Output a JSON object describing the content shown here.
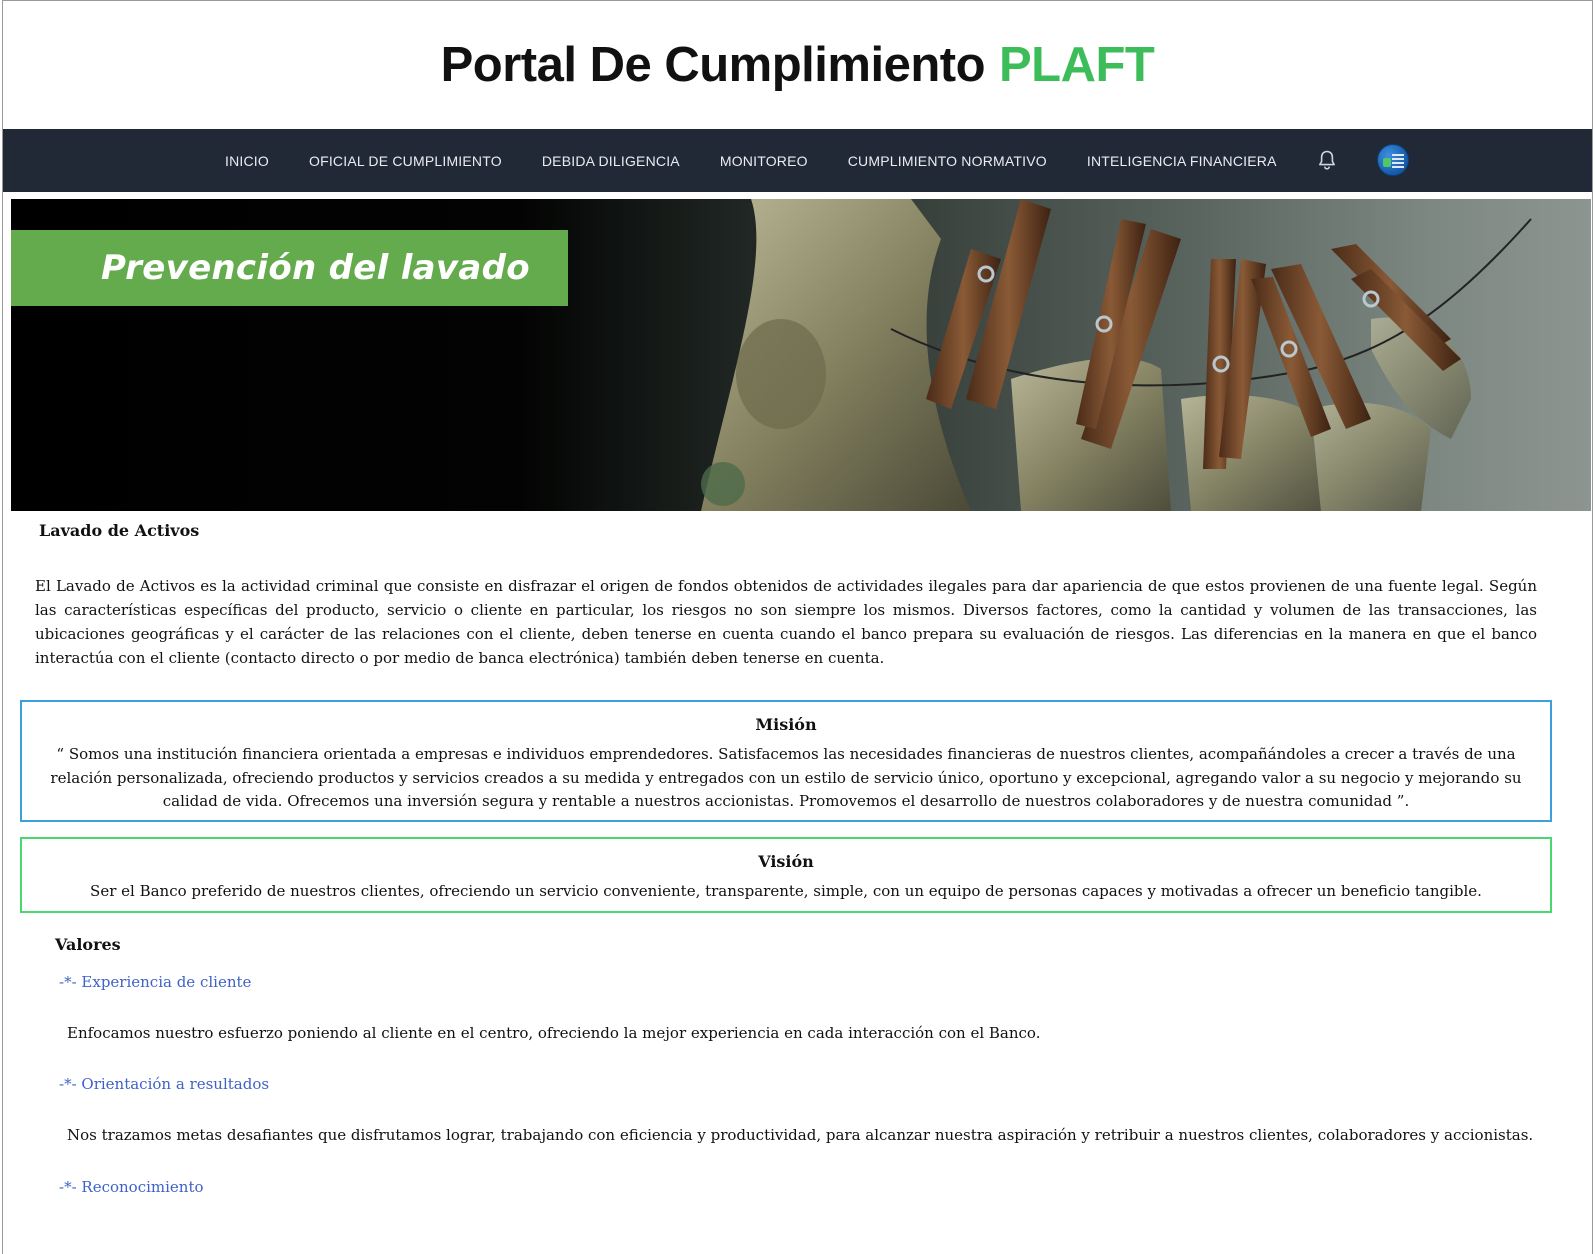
{
  "header": {
    "title": "Portal De Cumplimiento",
    "title_accent": "PLAFT"
  },
  "nav": {
    "items": [
      {
        "label": "INICIO"
      },
      {
        "label": "OFICIAL DE CUMPLIMIENTO"
      },
      {
        "label": "DEBIDA DILIGENCIA"
      },
      {
        "label": "MONITOREO"
      },
      {
        "label": "CUMPLIMIENTO NORMATIVO"
      },
      {
        "label": "INTELIGENCIA FINANCIERA"
      }
    ],
    "icons": [
      "bell-icon",
      "user-avatar"
    ]
  },
  "banner": {
    "label": "Prevención del lavado"
  },
  "colors": {
    "accent": "#3dbd5a",
    "navbar": "#222936",
    "mision_border": "#3da0dd",
    "vision_border": "#48d870",
    "link": "#3f62c8"
  },
  "lavado": {
    "title": "Lavado de Activos",
    "text": "El Lavado de Activos es la actividad criminal que consiste en disfrazar el origen de fondos obtenidos de actividades ilegales para dar apariencia de que estos provienen de una fuente legal. Según las características específicas del producto, servicio o cliente en particular, los riesgos no son siempre los mismos. Diversos factores, como la cantidad y volumen de las transacciones, las ubicaciones geográficas y el carácter de las relaciones con el cliente, deben tenerse en cuenta cuando el banco prepara su evaluación de riesgos. Las diferencias en la manera en que el banco interactúa con el cliente (contacto directo o por medio de banca electrónica) también deben tenerse en cuenta."
  },
  "mision": {
    "title": "Misión",
    "text": "“ Somos una institución financiera orientada a empresas e individuos emprendedores. Satisfacemos las necesidades financieras de nuestros clientes, acompañándoles a crecer a través de una relación personalizada, ofreciendo productos y servicios creados a su medida y entregados con un estilo de servicio único, oportuno y excepcional, agregando valor a su negocio y mejorando su calidad de vida. Ofrecemos una inversión segura y rentable a nuestros accionistas. Promovemos el desarrollo de nuestros colaboradores y de nuestra comunidad ”."
  },
  "vision": {
    "title": "Visión",
    "text": "Ser el Banco preferido de nuestros clientes, ofreciendo un servicio conveniente, transparente, simple, con un equipo de personas capaces y motivadas a ofrecer un beneficio tangible."
  },
  "valores": {
    "title": "Valores",
    "items": [
      {
        "title": "-*- Experiencia de cliente",
        "text": "Enfocamos nuestro esfuerzo poniendo al cliente en el centro, ofreciendo la mejor experiencia en cada interacción con el Banco."
      },
      {
        "title": "-*- Orientación a resultados",
        "text": "Nos trazamos metas desafiantes que disfrutamos lograr, trabajando con eficiencia y productividad, para alcanzar nuestra aspiración y retribuir a nuestros clientes, colaboradores y accionistas."
      },
      {
        "title": "-*- Reconocimiento",
        "text": ""
      }
    ]
  }
}
